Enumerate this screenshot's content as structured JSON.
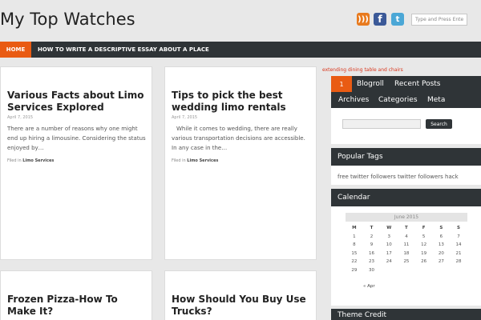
{
  "site": {
    "title": "My Top Watches"
  },
  "header": {
    "social": [
      {
        "icon": "rss-icon",
        "glyph": ")))",
        "color": "#e87a1e"
      },
      {
        "icon": "facebook-icon",
        "glyph": "f",
        "color": "#3b5998"
      },
      {
        "icon": "twitter-icon",
        "glyph": "t",
        "color": "#4ba7d6"
      }
    ],
    "search": {
      "placeholder": "Type and Press Enter"
    }
  },
  "nav": {
    "home": "HOME",
    "items": [
      "HOW TO WRITE A DESCRIPTIVE ESSAY ABOUT A PLACE"
    ],
    "active_color": "#e95b13",
    "bar_color": "#2f3437"
  },
  "posts": [
    {
      "title": "Various Facts about Limo Services Explored",
      "date": "April 7, 2015",
      "excerpt": "There are a number of reasons why one might end up hiring a limousine. Considering the status enjoyed by…",
      "filed_prefix": "Filed in",
      "category": "Limo Services"
    },
    {
      "title": "Tips to pick the best wedding limo rentals",
      "date": "April 7, 2015",
      "excerpt": "While it comes to wedding, there are really various transportation decisions are accessible. In any case in the…",
      "filed_prefix": "Filed in",
      "category": "Limo Services"
    },
    {
      "title": "Frozen Pizza-How To Make It?"
    },
    {
      "title": "How Should You Buy Use Trucks?"
    }
  ],
  "sidebar": {
    "ad_link": "extending dining table and chairs",
    "tabs": {
      "number": "1",
      "row1": [
        "Blogroll",
        "Recent Posts"
      ],
      "row2": [
        "Archives",
        "Categories",
        "Meta"
      ],
      "search_button": "Search"
    },
    "popular_tags": {
      "title": "Popular Tags",
      "tags": "free twitter followers twitter followers hack"
    },
    "calendar": {
      "title": "Calendar",
      "caption": "June 2015",
      "days": [
        "M",
        "T",
        "W",
        "T",
        "F",
        "S",
        "S"
      ],
      "weeks": [
        [
          "1",
          "2",
          "3",
          "4",
          "5",
          "6",
          "7"
        ],
        [
          "8",
          "9",
          "10",
          "11",
          "12",
          "13",
          "14"
        ],
        [
          "15",
          "16",
          "17",
          "18",
          "19",
          "20",
          "21"
        ],
        [
          "22",
          "23",
          "24",
          "25",
          "26",
          "27",
          "28"
        ],
        [
          "29",
          "30",
          "",
          "",
          "",
          "",
          ""
        ]
      ],
      "prev": "« Apr"
    },
    "theme_credit": {
      "title": "Theme Credit"
    }
  }
}
